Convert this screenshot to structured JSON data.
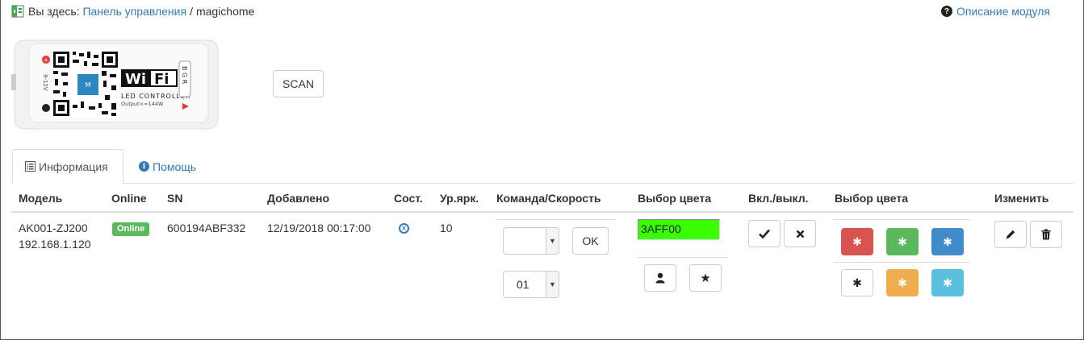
{
  "breadcrumb": {
    "prefix": "Вы здесь:",
    "link": "Панель управления",
    "separator": "/",
    "current": "magichome"
  },
  "module_description": "Описание модуля",
  "device_image": {
    "wifi_text": "Wi Fi",
    "led_controller": "LED CONTROLLER",
    "output": "Output<=144W",
    "voltage": "9-12V",
    "bgr": "B G R"
  },
  "scan_label": "SCAN",
  "tabs": [
    {
      "label": "Информация",
      "active": true
    },
    {
      "label": "Помощь",
      "active": false
    }
  ],
  "table": {
    "headers": {
      "model": "Модель",
      "online": "Online",
      "sn": "SN",
      "added": "Добавлено",
      "state": "Сост.",
      "brightness": "Ур.ярк.",
      "command": "Команда/Скорость",
      "color_pick": "Выбор цвета",
      "on_off": "Вкл./выкл.",
      "color_pick2": "Выбор цвета",
      "edit": "Изменить"
    },
    "row": {
      "model": "AK001-ZJ200",
      "ip": "192.168.1.120",
      "online_badge": "Online",
      "sn": "600194ABF332",
      "added": "12/19/2018 00:17:00",
      "brightness": "10",
      "command_value": "",
      "ok_label": "OK",
      "speed_value": "01",
      "color_value": "3AFF00"
    }
  },
  "colors": {
    "accent": "#337ab7",
    "online": "#5cb85c",
    "swatch_red": "#d9534f",
    "swatch_green": "#5cb85c",
    "swatch_blue": "#428bca",
    "swatch_white": "#ffffff",
    "swatch_orange": "#f0ad4e",
    "swatch_cyan": "#5bc0de",
    "picker_color": "#3aff00"
  },
  "icons": {
    "state": "times-circle-icon",
    "user": "user-icon",
    "star": "star-icon",
    "check": "check-icon",
    "close": "close-icon",
    "edit": "pencil-icon",
    "delete": "trash-icon",
    "color": "asterisk-icon"
  }
}
